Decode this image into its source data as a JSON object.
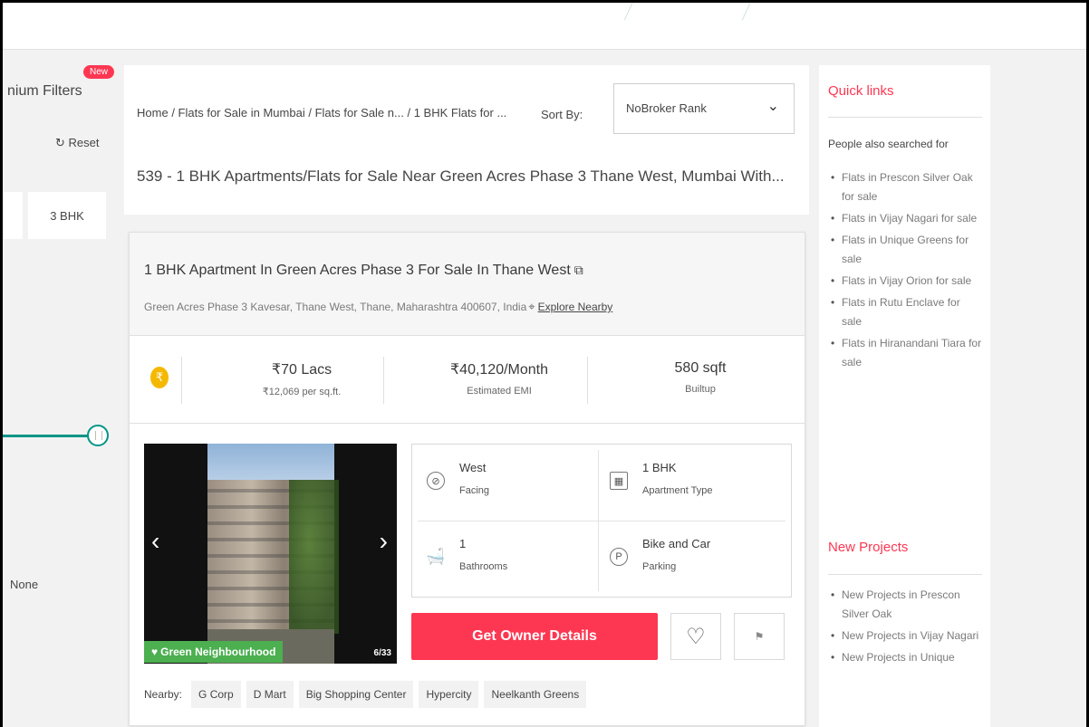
{
  "filters": {
    "title": "nium Filters",
    "new_badge": "New",
    "reset_label": "Reset",
    "bhk_chip": "3 BHK",
    "none_label": "None"
  },
  "header": {
    "breadcrumb": [
      "Home",
      "Flats for Sale in Mumbai",
      "Flats for Sale n...",
      "1 BHK Flats for ..."
    ],
    "sort_label": "Sort By:",
    "sort_value": "NoBroker Rank",
    "heading": "539 - 1 BHK Apartments/Flats for Sale Near Green Acres Phase 3 Thane West, Mumbai With..."
  },
  "property": {
    "title": "1 BHK Apartment In Green Acres Phase 3 For Sale In Thane West",
    "address": "Green Acres Phase 3  Kavesar, Thane West, Thane, Maharashtra 400607, India",
    "explore_label": "Explore Nearby",
    "price": "₹70 Lacs",
    "price_per_sqft": "₹12,069 per sq.ft.",
    "emi": "₹40,120/Month",
    "emi_label": "Estimated EMI",
    "area": "580 sqft",
    "area_label": "Builtup",
    "gallery_badge": "Green Neighbourhood",
    "gallery_count": "6/33",
    "specs": [
      {
        "value": "West",
        "label": "Facing"
      },
      {
        "value": "1 BHK",
        "label": "Apartment Type"
      },
      {
        "value": "1",
        "label": "Bathrooms"
      },
      {
        "value": "Bike and Car",
        "label": "Parking"
      }
    ],
    "owner_button": "Get Owner Details",
    "nearby_label": "Nearby:",
    "nearby": [
      "G Corp",
      "D Mart",
      "Big Shopping Center",
      "Hypercity",
      "Neelkanth Greens"
    ]
  },
  "sidebar": {
    "quick_links_title": "Quick links",
    "also_searched": "People also searched for",
    "links": [
      "Flats in Prescon Silver Oak for sale",
      "Flats in Vijay Nagari for sale",
      "Flats in Unique Greens for sale",
      "Flats in Vijay Orion for sale",
      "Flats in Rutu Enclave for sale",
      "Flats in Hiranandani Tiara for sale"
    ],
    "new_projects_title": "New Projects",
    "projects": [
      "New Projects in Prescon Silver Oak",
      "New Projects in Vijay Nagari",
      "New Projects in Unique"
    ]
  },
  "colors": {
    "accent": "#fd3752",
    "teal": "#009587",
    "green_badge": "#4caf50",
    "rupee": "#f5b800"
  }
}
